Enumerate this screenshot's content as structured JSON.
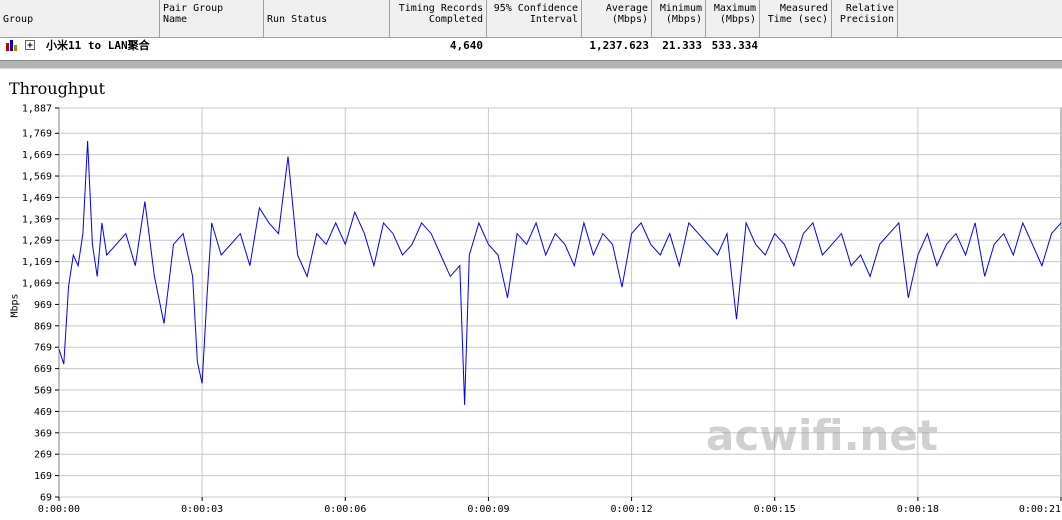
{
  "columns": {
    "group": [
      "Group"
    ],
    "pair_group_name": [
      "Pair Group",
      "Name"
    ],
    "run_status": [
      "Run Status"
    ],
    "timing_records": [
      "Timing Records",
      "Completed"
    ],
    "confidence": [
      "95% Confidence",
      "Interval"
    ],
    "average": [
      "Average",
      "(Mbps)"
    ],
    "minimum": [
      "Minimum",
      "(Mbps)"
    ],
    "maximum": [
      "Maximum",
      "(Mbps)"
    ],
    "measured_time": [
      "Measured",
      "Time (sec)"
    ],
    "relative_precision": [
      "Relative",
      "Precision"
    ]
  },
  "row": {
    "expand_icon": "expand-plus-icon",
    "group_icon": "chart-bars-icon",
    "pair_name": "小米11 to LAN聚合",
    "timing_records": "4,640",
    "confidence": "",
    "average": "1,237.623",
    "minimum": "21.333",
    "maximum": "533.334",
    "measured_time": "",
    "relative_precision": ""
  },
  "chart_data": {
    "type": "line",
    "title": "Throughput",
    "ylabel": "Mbps",
    "xlabel": "",
    "ylim": [
      69,
      1887
    ],
    "xlim_seconds": [
      0,
      21
    ],
    "yticks": [
      "1,887",
      "1,769",
      "1,669",
      "1,569",
      "1,469",
      "1,369",
      "1,269",
      "1,169",
      "1,069",
      "969",
      "869",
      "769",
      "669",
      "569",
      "469",
      "369",
      "269",
      "169",
      "69"
    ],
    "ytick_values": [
      1887,
      1769,
      1669,
      1569,
      1469,
      1369,
      1269,
      1169,
      1069,
      969,
      869,
      769,
      669,
      569,
      469,
      369,
      269,
      169,
      69
    ],
    "xticks": [
      "0:00:00",
      "0:00:03",
      "0:00:06",
      "0:00:09",
      "0:00:12",
      "0:00:15",
      "0:00:18",
      "0:00:21"
    ],
    "grid": true,
    "line_color": "#0000ff",
    "series": [
      {
        "x_seconds": [
          0,
          0.1,
          0.2,
          0.3,
          0.4,
          0.5,
          0.6,
          0.7,
          0.8,
          0.9,
          1.0,
          1.2,
          1.4,
          1.6,
          1.8,
          2.0,
          2.2,
          2.4,
          2.6,
          2.8,
          2.9,
          3.0,
          3.1,
          3.2,
          3.4,
          3.6,
          3.8,
          4.0,
          4.2,
          4.4,
          4.6,
          4.8,
          5.0,
          5.2,
          5.4,
          5.6,
          5.8,
          6.0,
          6.2,
          6.4,
          6.6,
          6.8,
          7.0,
          7.2,
          7.4,
          7.6,
          7.8,
          8.0,
          8.2,
          8.4,
          8.5,
          8.6,
          8.8,
          9.0,
          9.2,
          9.4,
          9.6,
          9.8,
          10.0,
          10.2,
          10.4,
          10.6,
          10.8,
          11.0,
          11.2,
          11.4,
          11.6,
          11.8,
          12.0,
          12.2,
          12.4,
          12.6,
          12.8,
          13.0,
          13.2,
          13.4,
          13.6,
          13.8,
          14.0,
          14.2,
          14.4,
          14.6,
          14.8,
          15.0,
          15.2,
          15.4,
          15.6,
          15.8,
          16.0,
          16.2,
          16.4,
          16.6,
          16.8,
          17.0,
          17.2,
          17.4,
          17.6,
          17.8,
          18.0,
          18.2,
          18.4,
          18.6,
          18.8,
          19.0,
          19.2,
          19.4,
          19.6,
          19.8,
          20.0,
          20.2,
          20.4,
          20.6,
          20.8,
          21.0
        ],
        "y": [
          760,
          690,
          1050,
          1200,
          1150,
          1300,
          1733,
          1250,
          1100,
          1350,
          1200,
          1250,
          1300,
          1150,
          1450,
          1100,
          880,
          1250,
          1300,
          1100,
          700,
          600,
          1000,
          1350,
          1200,
          1250,
          1300,
          1150,
          1420,
          1350,
          1300,
          1660,
          1200,
          1100,
          1300,
          1250,
          1350,
          1250,
          1400,
          1300,
          1150,
          1350,
          1300,
          1200,
          1250,
          1350,
          1300,
          1200,
          1100,
          1150,
          500,
          1200,
          1350,
          1250,
          1200,
          1000,
          1300,
          1250,
          1350,
          1200,
          1300,
          1250,
          1150,
          1350,
          1200,
          1300,
          1250,
          1050,
          1300,
          1350,
          1250,
          1200,
          1300,
          1150,
          1350,
          1300,
          1250,
          1200,
          1300,
          900,
          1350,
          1250,
          1200,
          1300,
          1250,
          1150,
          1300,
          1350,
          1200,
          1250,
          1300,
          1150,
          1200,
          1100,
          1250,
          1300,
          1350,
          1000,
          1200,
          1300,
          1150,
          1250,
          1300,
          1200,
          1350,
          1100,
          1250,
          1300,
          1200,
          1350,
          1250,
          1150,
          1300,
          1350,
          1200,
          1100
        ]
      }
    ]
  },
  "watermark": "acwifi.net"
}
